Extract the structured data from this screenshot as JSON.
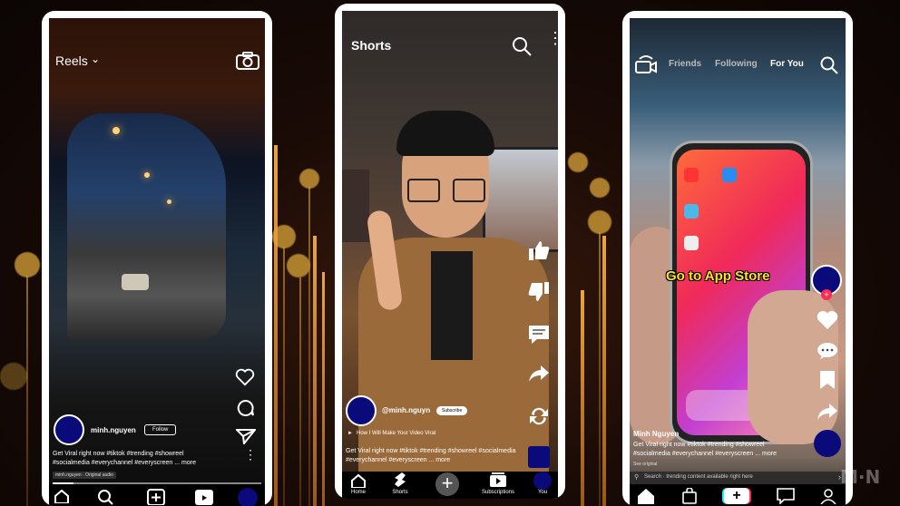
{
  "phone_reels": {
    "header_title": "Reels",
    "username": "minh.nguyen",
    "follow_label": "Follow",
    "caption": "Get Viral right now #tiktok #trending #showreel #socialmedia #everychannel #everyscreen ... more",
    "audio_label": "minh.nguyen · Original audio"
  },
  "phone_shorts": {
    "header_title": "Shorts",
    "username": "@minh.nguyn",
    "subscribe_label": "Subscribe",
    "video_title": "How I Will Make Your Video Viral",
    "caption": "Get Viral right now #tiktok #trending #showreel #socialmedia #everychannel #everyscreen ... more",
    "nav": [
      "Home",
      "Shorts",
      "",
      "Subscriptions",
      "You"
    ]
  },
  "phone_tiktok": {
    "tabs": [
      "Friends",
      "Following",
      "For You"
    ],
    "overlay_text": "Go to App Store",
    "username": "Minh Nguyen",
    "caption": "Get Viral right now #tiktok #trending #showreel #socialmedia #everychannel #everyscreen ... more",
    "see_original": "See original",
    "search_text": "Search · trending content available right here"
  },
  "watermark": "M·N"
}
